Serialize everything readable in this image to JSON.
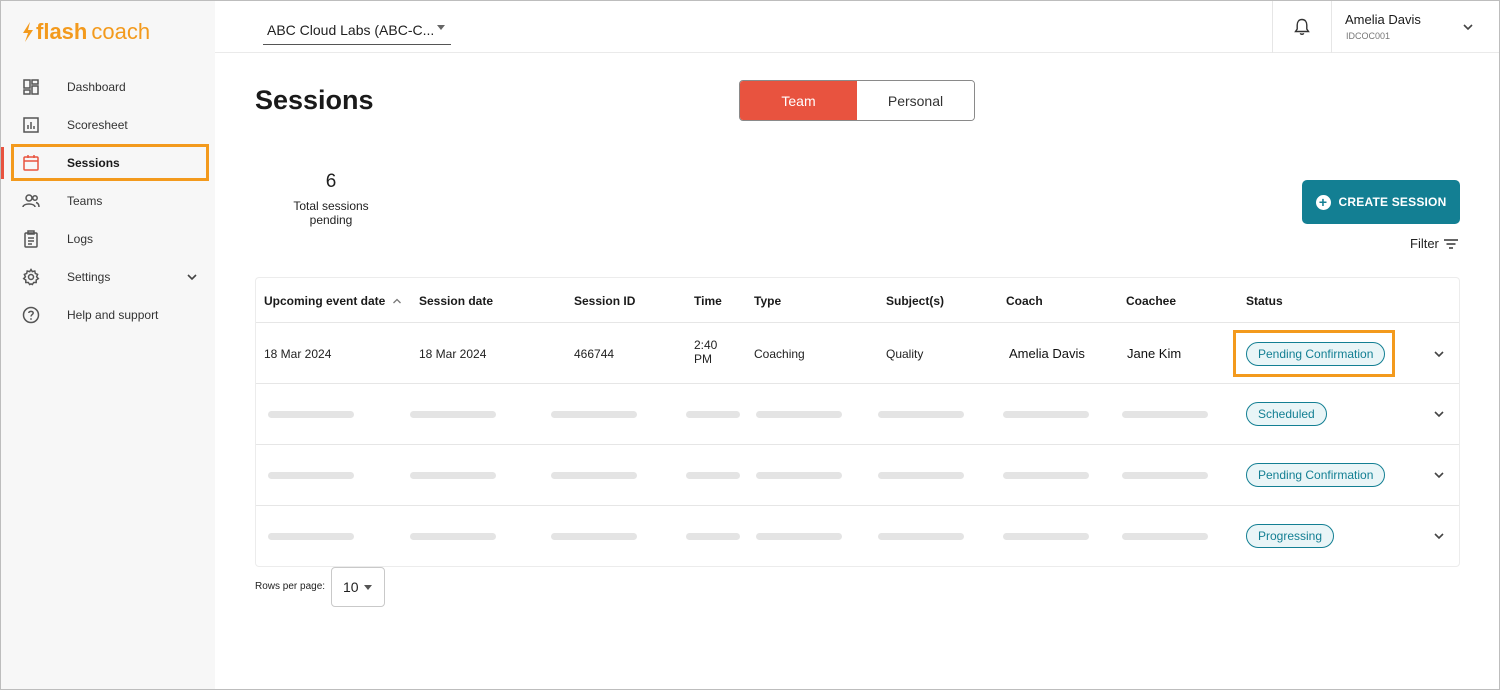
{
  "brand": {
    "part1": "flash",
    "part2": "coach",
    "color": "#f39a1d"
  },
  "sidebar": {
    "items": [
      {
        "label": "Dashboard",
        "icon": "dashboard-icon"
      },
      {
        "label": "Scoresheet",
        "icon": "chart-icon"
      },
      {
        "label": "Sessions",
        "icon": "calendar-icon",
        "active": true
      },
      {
        "label": "Teams",
        "icon": "people-icon"
      },
      {
        "label": "Logs",
        "icon": "clipboard-icon"
      },
      {
        "label": "Settings",
        "icon": "gear-icon",
        "expandable": true
      },
      {
        "label": "Help and support",
        "icon": "help-icon"
      }
    ]
  },
  "topbar": {
    "org_select": "ABC Cloud Labs (ABC-C...",
    "user_name": "Amelia Davis",
    "user_id": "IDCOC001"
  },
  "page": {
    "title": "Sessions",
    "toggle": {
      "team": "Team",
      "personal": "Personal",
      "selected": "Team"
    },
    "stat_value": "6",
    "stat_label": "Total sessions pending",
    "create_button": "CREATE SESSION",
    "filter_label": "Filter"
  },
  "table": {
    "columns": [
      "Upcoming event date",
      "Session date",
      "Session ID",
      "Time",
      "Type",
      "Subject(s)",
      "Coach",
      "Coachee",
      "Status"
    ],
    "sort_indicator": "^",
    "rows": [
      {
        "upcoming_event_date": "18 Mar 2024",
        "session_date": "18 Mar 2024",
        "session_id": "466744",
        "time_line1": "2:40",
        "time_line2": "PM",
        "type": "Coaching",
        "subjects": "Quality",
        "coach": "Amelia Davis",
        "coachee": "Jane Kim",
        "status": "Pending Confirmation"
      },
      {
        "placeholder": true,
        "status": "Scheduled"
      },
      {
        "placeholder": true,
        "status": "Pending Confirmation"
      },
      {
        "placeholder": true,
        "status": "Progressing"
      }
    ]
  },
  "pagination": {
    "rows_per_page_label": "Rows per page:",
    "rows_per_page_value": "10"
  },
  "colors": {
    "accent_red": "#e8533f",
    "teal": "#137f93",
    "highlight_orange": "#f39a1d"
  }
}
